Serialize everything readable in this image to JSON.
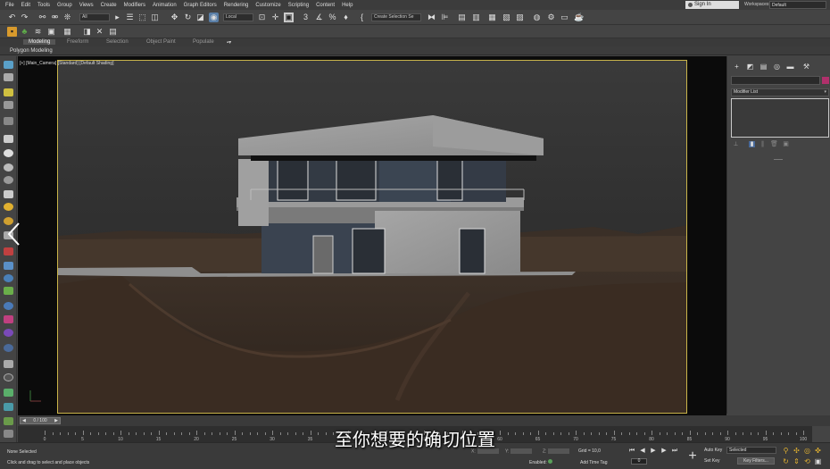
{
  "menu": [
    "File",
    "Edit",
    "Tools",
    "Group",
    "Views",
    "Create",
    "Modifiers",
    "Animation",
    "Graph Editors",
    "Rendering",
    "Customize",
    "Scripting",
    "Content",
    "Help"
  ],
  "account": {
    "signin": "Sign In",
    "workspaces_label": "Workspaces:",
    "workspace": "Default"
  },
  "toolbar": {
    "filter": "All",
    "ref_coord": "Local",
    "selection_set": "Create Selection Se"
  },
  "ribbon": {
    "tabs": [
      "Modeling",
      "Freeform",
      "Selection",
      "Object Paint",
      "Populate"
    ],
    "active": "Modeling",
    "sub_label": "Polygon Modeling"
  },
  "viewport": {
    "label": "[+] [Main_Camera] [Standard] [Default Shading]"
  },
  "command_panel": {
    "modifier_list": "Modifier List"
  },
  "timeline": {
    "slider": "0 / 100",
    "ticks": [
      "0",
      "5",
      "10",
      "15",
      "20",
      "25",
      "30",
      "35",
      "40",
      "45",
      "50",
      "55",
      "60",
      "65",
      "70",
      "75",
      "80",
      "85",
      "90",
      "95",
      "100"
    ]
  },
  "status": {
    "selection": "None Selected",
    "prompt": "Click and drag to select and place objects",
    "x_label": "X:",
    "y_label": "Y:",
    "z_label": "Z:",
    "grid": "Grid = 10,0",
    "enabled": "Enabled:",
    "add_time_tag": "Add Time Tag",
    "frame": "0",
    "auto_key": "Auto Key",
    "set_key": "Set Key",
    "selected": "Selected",
    "key_filters": "Key Filters..."
  },
  "subtitle": "至你想要的确切位置",
  "colors": {
    "accent_yellow": "#c9b44a",
    "swatch": "#b0306b",
    "nav_icon": "#e0b030"
  }
}
